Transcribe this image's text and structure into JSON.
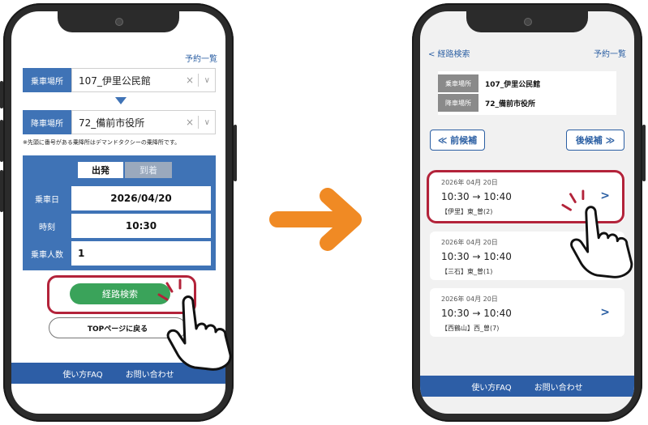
{
  "left_screen": {
    "reservation_link": "予約一覧",
    "boarding_label": "乗車場所",
    "boarding_value": "107_伊里公民館",
    "alighting_label": "降車場所",
    "alighting_value": "72_備前市役所",
    "clear_icon": "×",
    "dropdown_icon": "∨",
    "note": "※先頭に番号がある乗降所はデマンドタクシーの乗降所です。",
    "tab_depart": "出発",
    "tab_arrive": "到着",
    "date_label": "乗車日",
    "date_value": "2026/04/20",
    "time_label": "時刻",
    "time_value": "10:30",
    "passengers_label": "乗車人数",
    "passengers_value": "1",
    "search_button": "経路検索",
    "top_button": "TOPページに戻る",
    "footer_faq": "使い方FAQ",
    "footer_contact": "お問い合わせ"
  },
  "right_screen": {
    "back_link": "< 経路検索",
    "reservation_link": "予約一覧",
    "boarding_label": "乗車場所",
    "boarding_value": "107_伊里公民館",
    "alighting_label": "降車場所",
    "alighting_value": "72_備前市役所",
    "prev_button": "≪ 前候補",
    "next_button": "後候補 ≫",
    "results": [
      {
        "date": "2026年 04月 20日",
        "time": "10:30  →  10:40",
        "route": "【伊里】東_曽(2)"
      },
      {
        "date": "2026年 04月 20日",
        "time": "10:30  →  10:40",
        "route": "【三石】東_曽(1)"
      },
      {
        "date": "2026年 04月 20日",
        "time": "10:30  →  10:40",
        "route": "【西鶴山】西_曽(7)"
      }
    ],
    "chevron": ">",
    "footer_faq": "使い方FAQ",
    "footer_contact": "お問い合わせ"
  },
  "colors": {
    "primary_blue": "#3f73b6",
    "footer_blue": "#2d5ea6",
    "green_button": "#3aa35a",
    "highlight_red": "#b3233a",
    "arrow_orange": "#f08a24"
  }
}
